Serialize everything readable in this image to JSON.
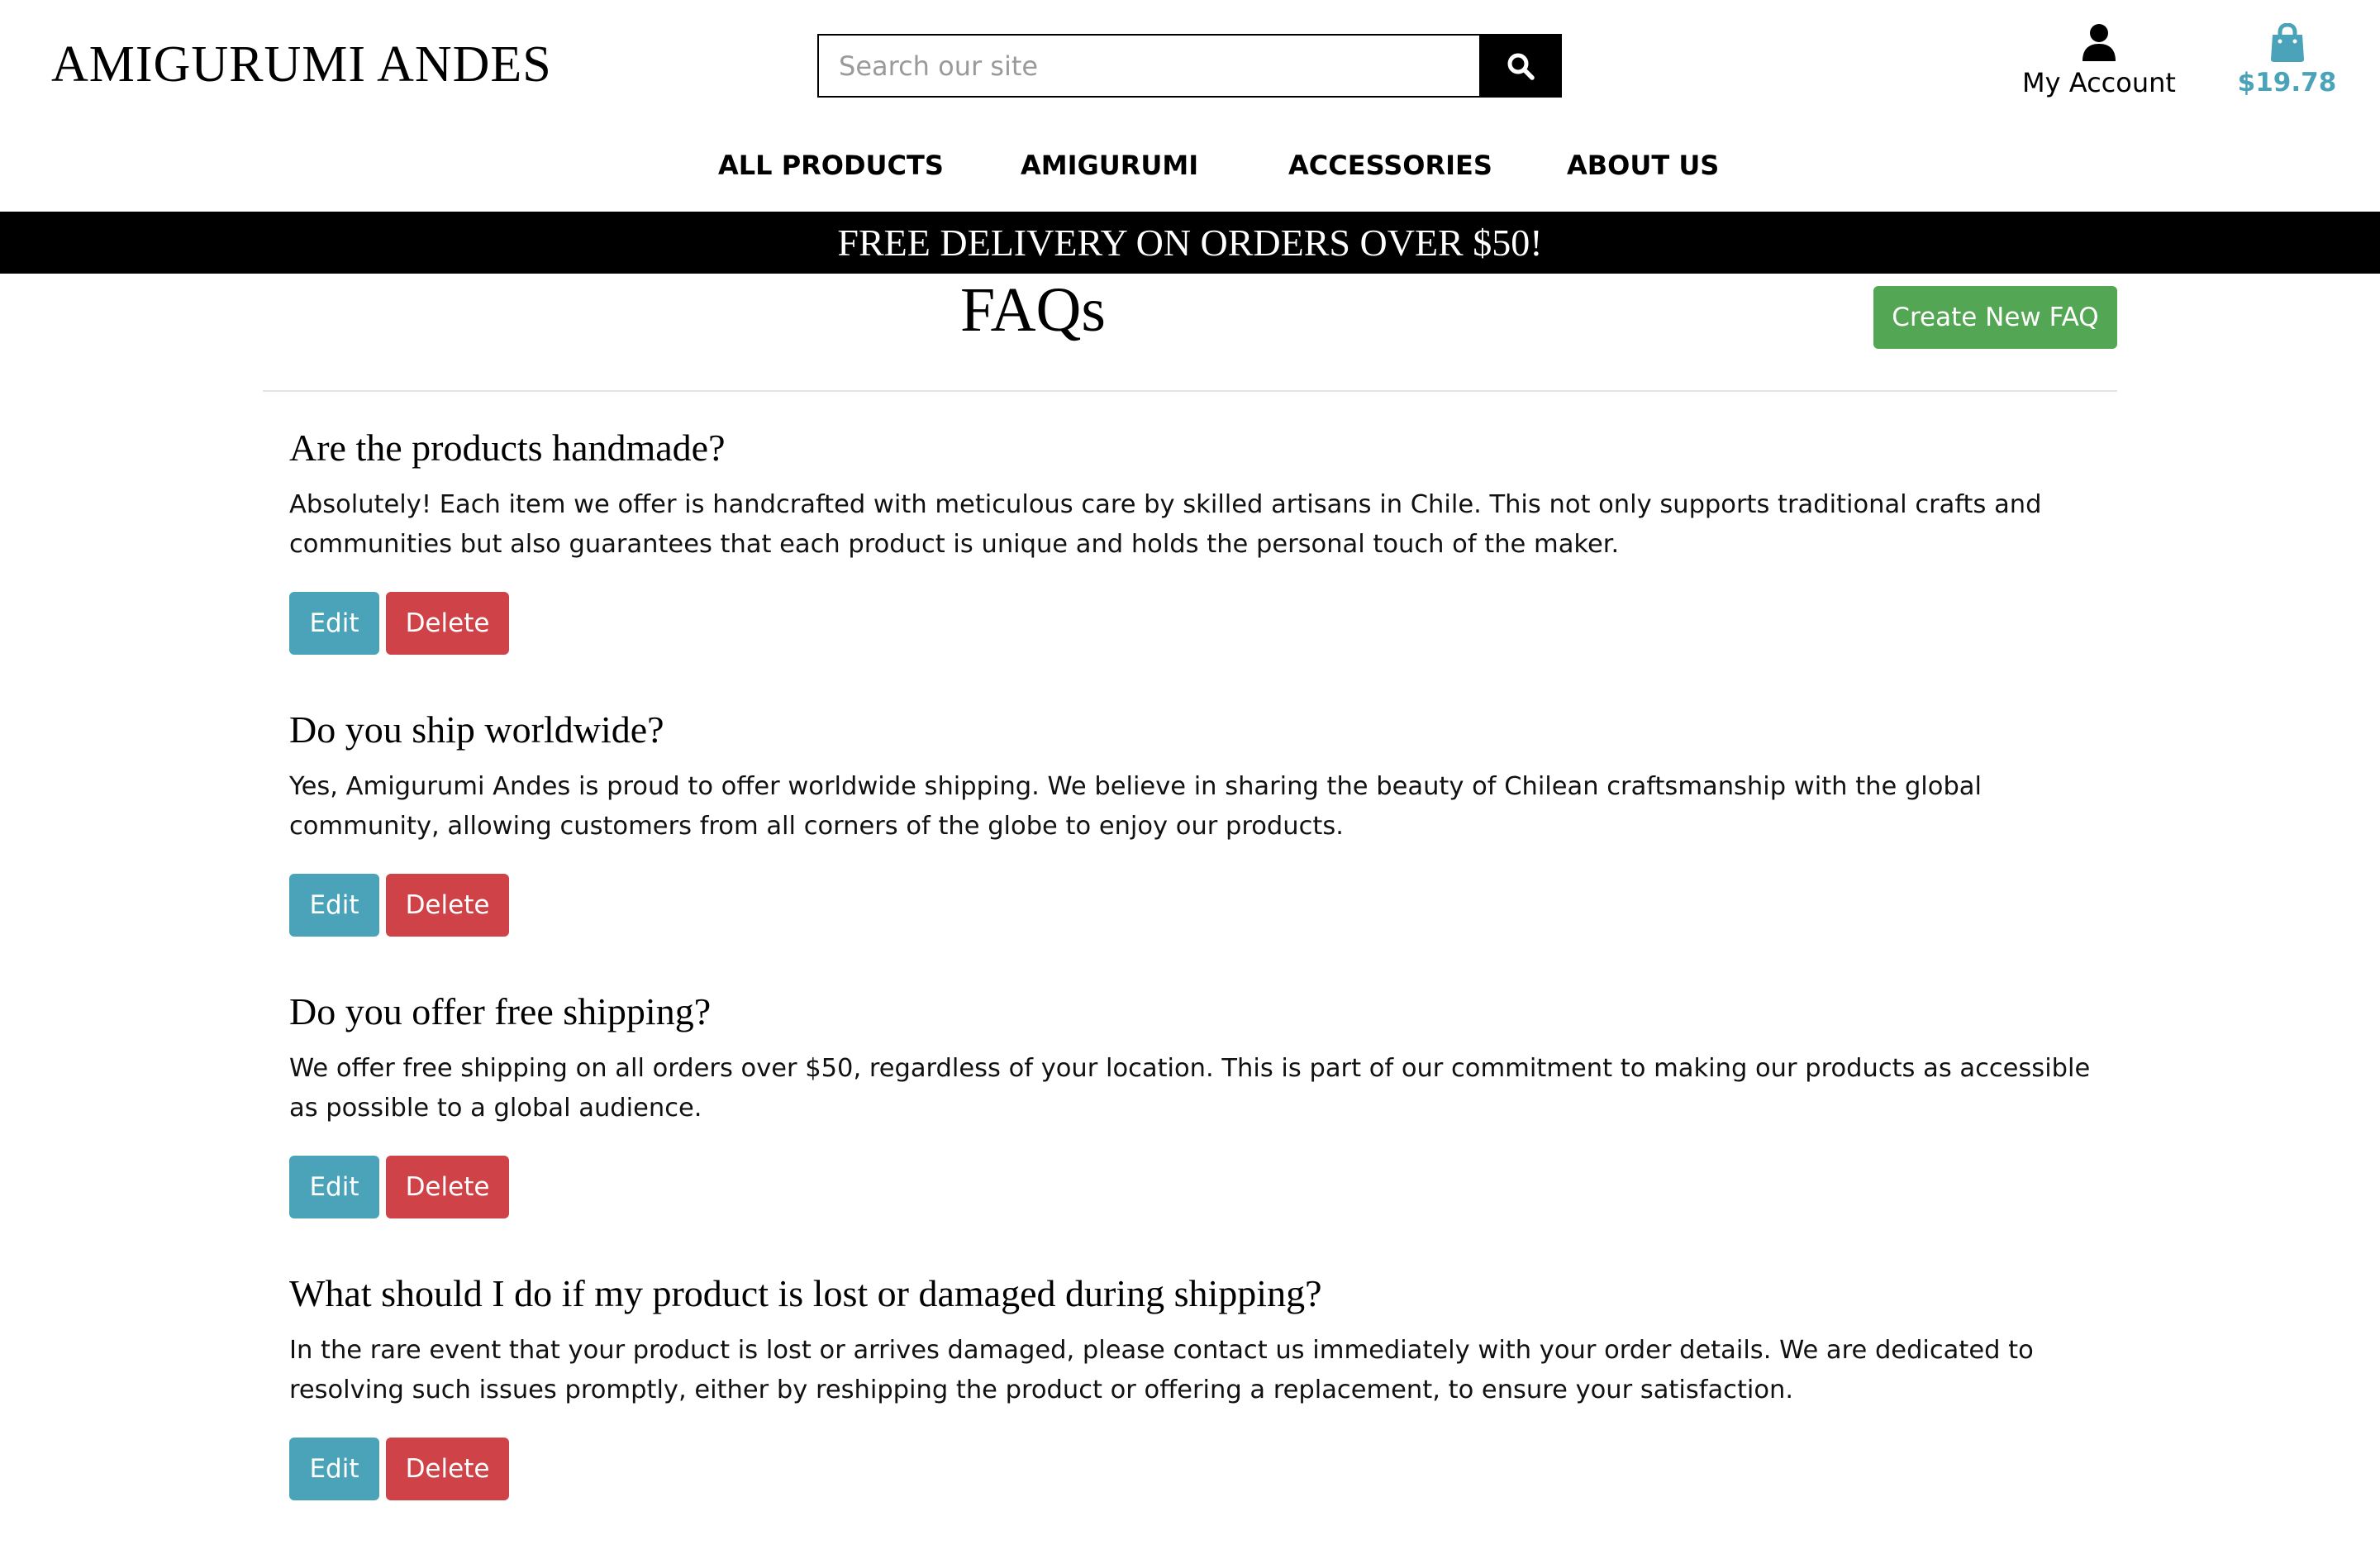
{
  "site": {
    "logo": "AMIGURUMI ANDES"
  },
  "search": {
    "placeholder": "Search our site",
    "button_icon": "search-icon"
  },
  "account": {
    "label": "My Account",
    "icon": "user-icon"
  },
  "cart": {
    "total": "$19.78",
    "icon": "shopping-bag-icon",
    "color": "#4aa3b8"
  },
  "nav": {
    "items": [
      {
        "label": "ALL PRODUCTS"
      },
      {
        "label": "AMIGURUMI"
      },
      {
        "label": "ACCESSORIES"
      },
      {
        "label": "ABOUT US"
      }
    ]
  },
  "banner": {
    "text": "FREE DELIVERY ON ORDERS OVER $50!"
  },
  "main": {
    "title": "FAQs",
    "create_label": "Create New FAQ",
    "create_color": "#53a653"
  },
  "faqs": [
    {
      "question": "Are the products handmade?",
      "answer": "Absolutely! Each item we offer is handcrafted with meticulous care by skilled artisans in Chile. This not only supports traditional crafts and communities but also guarantees that each product is unique and holds the personal touch of the maker.",
      "edit_label": "Edit",
      "delete_label": "Delete"
    },
    {
      "question": "Do you ship worldwide?",
      "answer": "Yes, Amigurumi Andes is proud to offer worldwide shipping. We believe in sharing the beauty of Chilean craftsmanship with the global community, allowing customers from all corners of the globe to enjoy our products.",
      "edit_label": "Edit",
      "delete_label": "Delete"
    },
    {
      "question": "Do you offer free shipping?",
      "answer": "We offer free shipping on all orders over $50, regardless of your location. This is part of our commitment to making our products as accessible as possible to a global audience.",
      "edit_label": "Edit",
      "delete_label": "Delete"
    },
    {
      "question": "What should I do if my product is lost or damaged during shipping?",
      "answer": "In the rare event that your product is lost or arrives damaged, please contact us immediately with your order details. We are dedicated to resolving such issues promptly, either by reshipping the product or offering a replacement, to ensure your satisfaction.",
      "edit_label": "Edit",
      "delete_label": "Delete"
    }
  ],
  "button_colors": {
    "edit": "#4aa3b8",
    "delete": "#cf4348"
  }
}
